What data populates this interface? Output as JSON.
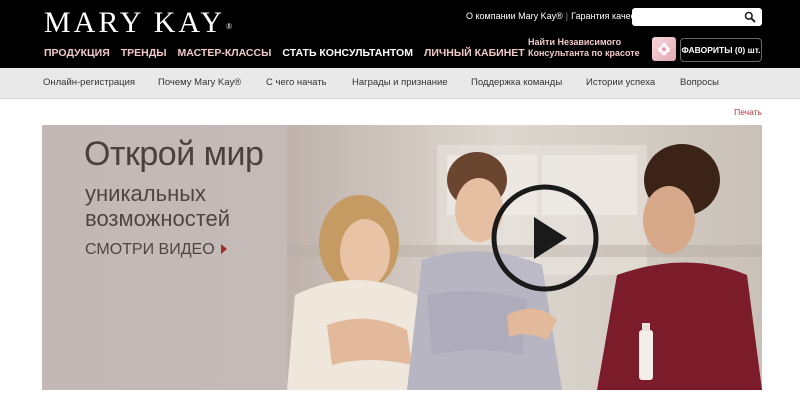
{
  "brand": {
    "logo": "MARY KAY",
    "logo_mark": "®"
  },
  "top_links": [
    {
      "label": "О компании Mary Kay®"
    },
    {
      "label": "Гарантия качества"
    }
  ],
  "search": {
    "value": "",
    "placeholder": ""
  },
  "main_nav": [
    {
      "label": "ПРОДУКЦИЯ"
    },
    {
      "label": "ТРЕНДЫ"
    },
    {
      "label": "МАСТЕР-КЛАССЫ"
    },
    {
      "label": "СТАТЬ КОНСУЛЬТАНТОМ"
    },
    {
      "label": "ЛИЧНЫЙ КАБИНЕТ"
    }
  ],
  "find_consultant": {
    "line1": "Найти Независимого",
    "line2": "Консультанта по красоте"
  },
  "favorites": {
    "label": "ФАВОРИТЫ (0) шт."
  },
  "sub_nav": [
    {
      "label": "Онлайн-регистрация"
    },
    {
      "label": "Почему Mary Kay®"
    },
    {
      "label": "С чего начать"
    },
    {
      "label": "Награды и признание"
    },
    {
      "label": "Поддержка команды"
    },
    {
      "label": "Истории успеха"
    },
    {
      "label": "Вопросы"
    }
  ],
  "print_label": "Печать",
  "hero": {
    "title": "Открой мир",
    "subtitle_1": "уникальных",
    "subtitle_2": "возможностей",
    "cta": "СМОТРИ ВИДЕО"
  },
  "colors": {
    "accent": "#a02b2b",
    "nav_pink": "#f0c9c8",
    "topbar": "#000000"
  }
}
